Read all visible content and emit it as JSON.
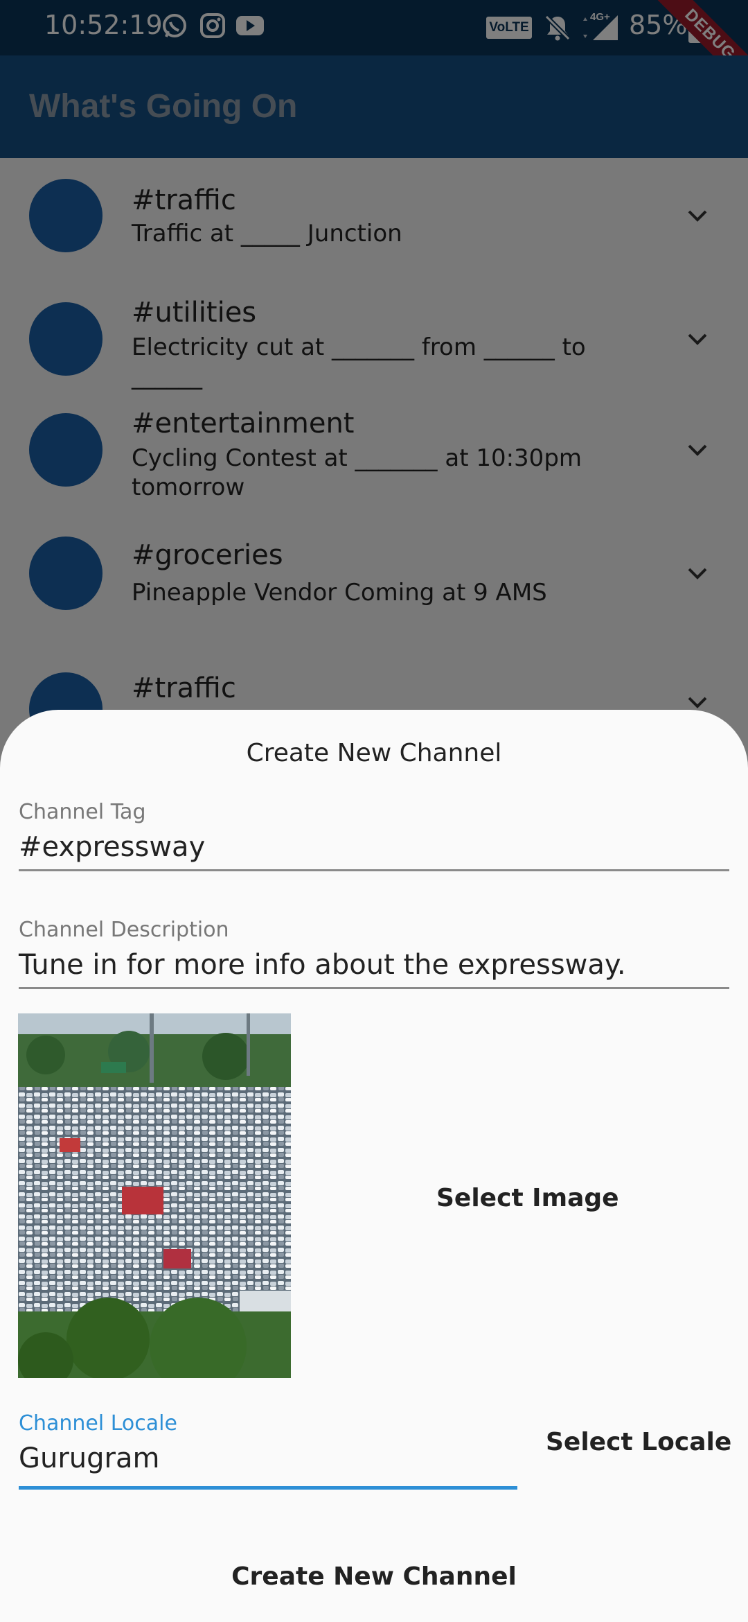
{
  "status_bar": {
    "time": "10:52:19",
    "network_label": "VoLTE",
    "signal_label": "4G+",
    "battery": "85%",
    "debug_banner": "DEBUG"
  },
  "app_bar": {
    "title": "What's Going On"
  },
  "feed": {
    "items": [
      {
        "tag": "#traffic",
        "description": "Traffic at _____ Junction"
      },
      {
        "tag": "#utilities",
        "description": "Electricity cut at _______ from ______ to ______"
      },
      {
        "tag": "#entertainment",
        "description": "Cycling Contest at _______ at 10:30pm tomorrow"
      },
      {
        "tag": "#groceries",
        "description": "Pineapple Vendor Coming at 9 AMS"
      },
      {
        "tag": "#traffic",
        "description": ""
      }
    ]
  },
  "sheet": {
    "title": "Create New Channel",
    "tag_field": {
      "label": "Channel Tag",
      "value": "#expressway"
    },
    "description_field": {
      "label": "Channel Description",
      "value": "Tune in for more info about the expressway."
    },
    "select_image_label": "Select Image",
    "locale_field": {
      "label": "Channel Locale",
      "value": "Gurugram"
    },
    "select_locale_label": "Select Locale",
    "create_button_label": "Create New Channel"
  },
  "colors": {
    "status_bar": "#0b3558",
    "app_bar": "#144e82",
    "avatar": "#1b5ea4",
    "accent": "#2d8fd6",
    "debug": "#9b1b2b"
  }
}
